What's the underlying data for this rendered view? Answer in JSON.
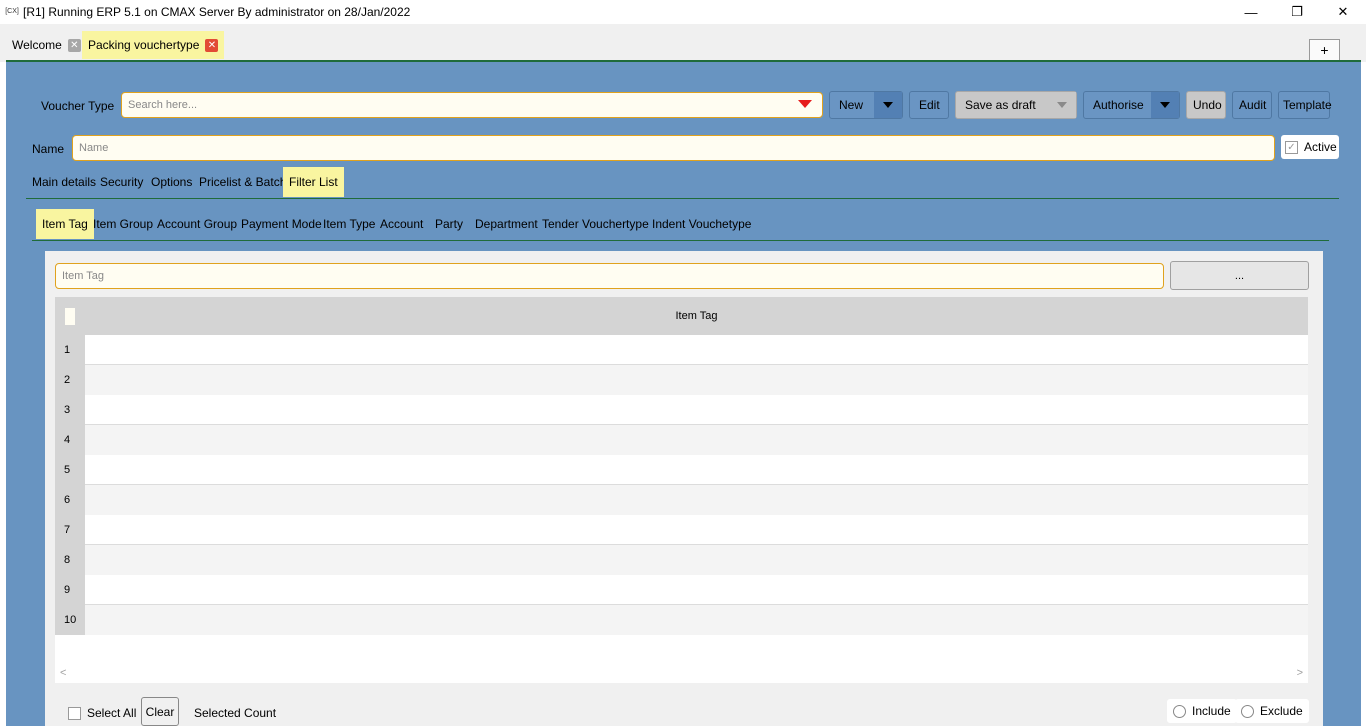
{
  "window": {
    "icon_text": "[CX]",
    "title": "[R1] Running ERP 5.1 on CMAX Server By administrator on 28/Jan/2022",
    "minimize": "—",
    "restore": "❐",
    "close": "✕"
  },
  "tabs": [
    {
      "label": "Welcome",
      "close": "✕"
    },
    {
      "label": "Packing vouchertype",
      "close": "✕"
    }
  ],
  "plus_label": "+",
  "toolbar": {
    "voucher_type_label": "Voucher Type",
    "search_placeholder": "Search here...",
    "new_label": "New",
    "edit_label": "Edit",
    "save_draft_label": "Save as draft",
    "authorise_label": "Authorise",
    "undo_label": "Undo",
    "audit_label": "Audit",
    "template_label": "Template"
  },
  "name_row": {
    "label": "Name",
    "placeholder": "Name",
    "active_label": "Active",
    "active_check": "✓"
  },
  "main_tabs": [
    "Main details",
    "Security",
    "Options",
    "Pricelist & Batch",
    "Filter List"
  ],
  "filter_tabs": [
    "Item Tag",
    "Item Group",
    "Account Group",
    "Payment Mode",
    "Item Type",
    "Account",
    "Party",
    "Department",
    "Tender Vouchertype",
    "Indent Vouchetype"
  ],
  "filter_panel": {
    "input_placeholder": "Item Tag",
    "browse_label": "...",
    "column_header": "Item Tag",
    "rows": [
      "1",
      "2",
      "3",
      "4",
      "5",
      "6",
      "7",
      "8",
      "9",
      "10"
    ],
    "scroll_left": "<",
    "scroll_right": ">"
  },
  "bottom": {
    "select_all": "Select All",
    "clear": "Clear",
    "selected_count": "Selected Count",
    "include": "Include",
    "exclude": "Exclude"
  }
}
